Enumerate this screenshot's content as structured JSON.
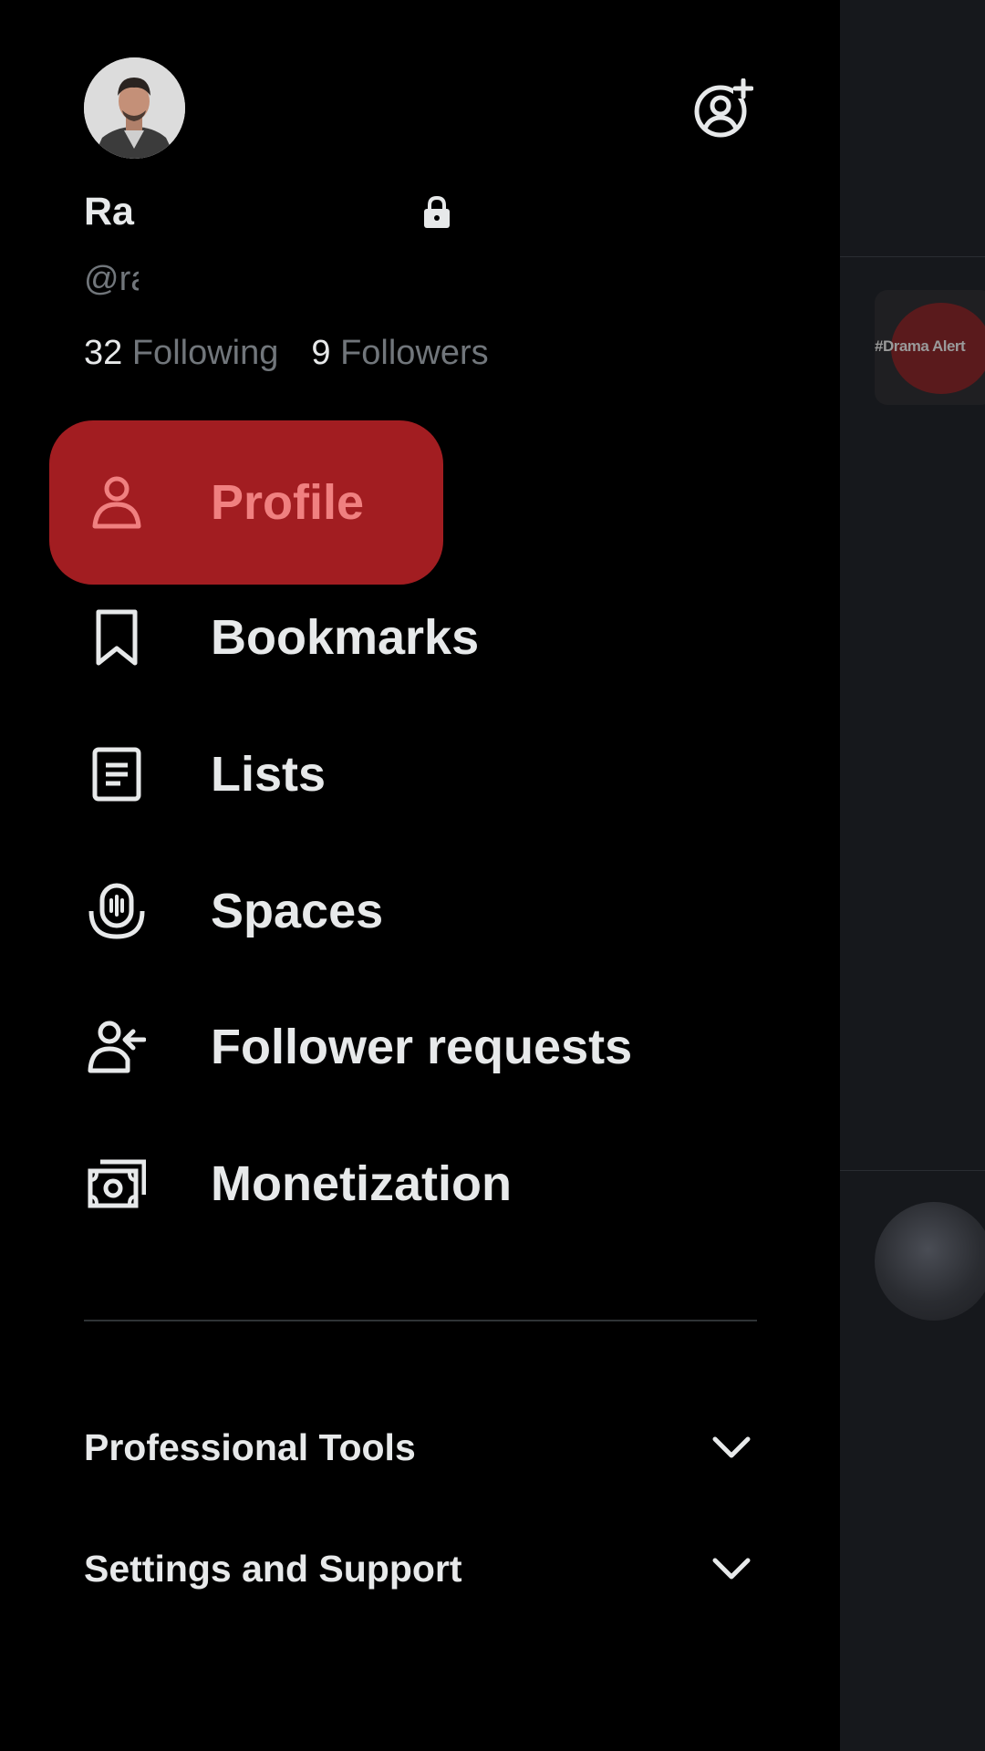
{
  "profile": {
    "display_name": "Ra",
    "handle": "@ra",
    "following_count": "32",
    "following_label": "Following",
    "followers_count": "9",
    "followers_label": "Followers"
  },
  "nav": {
    "items": [
      {
        "label": "Profile",
        "icon": "person-icon",
        "active": true
      },
      {
        "label": "Bookmarks",
        "icon": "bookmark-icon"
      },
      {
        "label": "Lists",
        "icon": "list-icon"
      },
      {
        "label": "Spaces",
        "icon": "spaces-microphone-icon"
      },
      {
        "label": "Follower requests",
        "icon": "follower-request-icon"
      },
      {
        "label": "Monetization",
        "icon": "money-icon"
      }
    ]
  },
  "sections": {
    "professional_tools": "Professional Tools",
    "settings_support": "Settings and Support"
  },
  "background": {
    "hashtag": "#Drama Alert"
  },
  "colors": {
    "background": "#000000",
    "active_bg": "#a21d21",
    "active_text": "#f08080",
    "text_primary": "#e7e9ea",
    "text_secondary": "#71767b"
  }
}
